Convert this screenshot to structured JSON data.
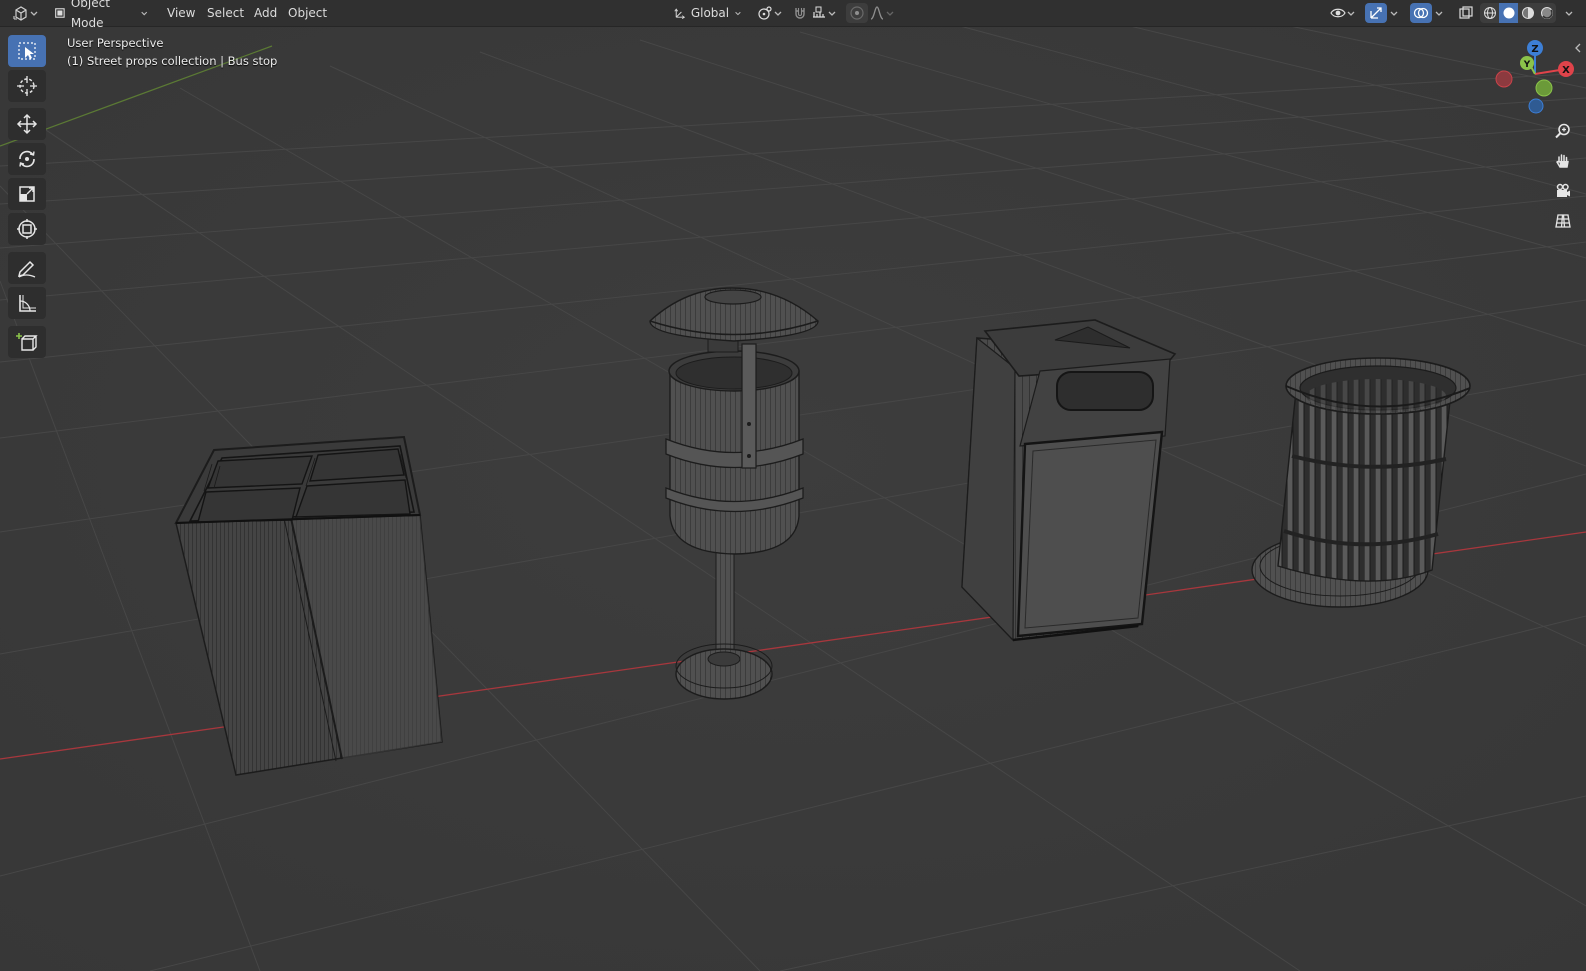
{
  "header": {
    "editor_type_icon": "3d-viewport-icon",
    "mode": {
      "label": "Object Mode",
      "icon": "object-mode-icon"
    },
    "menus": [
      "View",
      "Select",
      "Add",
      "Object"
    ],
    "transform_orientation": {
      "label": "Global",
      "icon": "orientation-axes-icon"
    },
    "pivot_icon": "pivot-point-icon",
    "snap_icon": "snap-magnet-icon",
    "snap_target_icon": "snap-increment-icon",
    "proportional_icon": "proportional-edit-icon",
    "falloff_icon": "falloff-curve-icon",
    "visibility_icon": "eye-visibility-icon",
    "gizmo_icon": "gizmo-icon",
    "overlay_icon": "overlay-icon",
    "xray_icon": "xray-icon",
    "shading_modes": [
      {
        "name": "wireframe-shading-icon",
        "active": false
      },
      {
        "name": "solid-shading-icon",
        "active": true
      },
      {
        "name": "material-preview-icon",
        "active": false
      },
      {
        "name": "rendered-shading-icon",
        "active": false
      }
    ]
  },
  "viewport": {
    "perspective_label": "User Perspective",
    "collection_label": "(1) Street props collection | Bus stop"
  },
  "toolbar": {
    "tools": [
      {
        "name": "select-box-tool",
        "active": true
      },
      {
        "name": "cursor-tool",
        "active": false
      },
      {
        "name": "move-tool",
        "active": false
      },
      {
        "name": "rotate-tool",
        "active": false
      },
      {
        "name": "scale-tool",
        "active": false
      },
      {
        "name": "transform-tool",
        "active": false
      },
      {
        "name": "annotate-tool",
        "active": false
      },
      {
        "name": "measure-tool",
        "active": false
      },
      {
        "name": "add-cube-tool",
        "active": false
      }
    ]
  },
  "navigation": {
    "gizmo_axes": {
      "x": {
        "label": "X",
        "color": "#e0434a"
      },
      "y": {
        "label": "Y",
        "color": "#8bc34a"
      },
      "z": {
        "label": "Z",
        "color": "#3d7fd6"
      }
    },
    "buttons": [
      "zoom-icon",
      "pan-hand-icon",
      "camera-icon",
      "grid-ortho-icon"
    ]
  },
  "colors": {
    "accent": "#4772b3",
    "x_axis_line": "#a8373d",
    "y_axis_line": "#5b7a34",
    "grid_line": "#454545",
    "object_fill": "#474747",
    "wire": "#1c1c1c"
  }
}
